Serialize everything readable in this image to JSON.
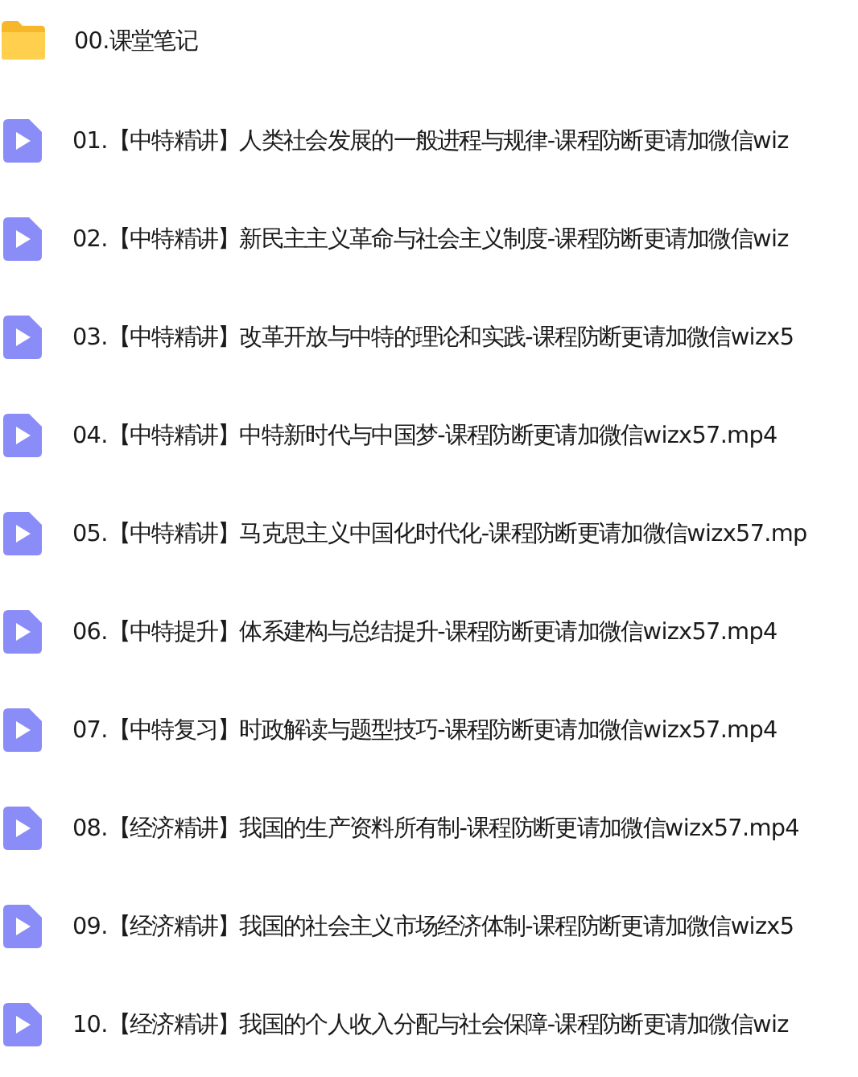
{
  "files": [
    {
      "kind": "folder",
      "name": "00.课堂笔记"
    },
    {
      "kind": "video",
      "name": "01.【中特精讲】人类社会发展的一般进程与规律-课程防断更请加微信wiz"
    },
    {
      "kind": "video",
      "name": "02.【中特精讲】新民主主义革命与社会主义制度-课程防断更请加微信wiz"
    },
    {
      "kind": "video",
      "name": "03.【中特精讲】改革开放与中特的理论和实践-课程防断更请加微信wizx5"
    },
    {
      "kind": "video",
      "name": "04.【中特精讲】中特新时代与中国梦-课程防断更请加微信wizx57.mp4"
    },
    {
      "kind": "video",
      "name": "05.【中特精讲】马克思主义中国化时代化-课程防断更请加微信wizx57.mp"
    },
    {
      "kind": "video",
      "name": "06.【中特提升】体系建构与总结提升-课程防断更请加微信wizx57.mp4"
    },
    {
      "kind": "video",
      "name": "07.【中特复习】时政解读与题型技巧-课程防断更请加微信wizx57.mp4"
    },
    {
      "kind": "video",
      "name": "08.【经济精讲】我国的生产资料所有制-课程防断更请加微信wizx57.mp4"
    },
    {
      "kind": "video",
      "name": "09.【经济精讲】我国的社会主义市场经济体制-课程防断更请加微信wizx5"
    },
    {
      "kind": "video",
      "name": "10.【经济精讲】我国的个人收入分配与社会保障-课程防断更请加微信wiz"
    }
  ]
}
